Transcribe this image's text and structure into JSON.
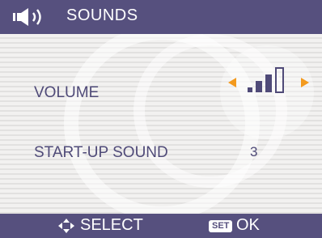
{
  "header": {
    "icon": "speaker-icon",
    "title": "SOUNDS"
  },
  "menu": {
    "items": [
      {
        "label": "VOLUME",
        "control": "volume-level",
        "level": 3,
        "max_level": 4
      },
      {
        "label": "START-UP SOUND",
        "value": "3"
      }
    ]
  },
  "footer": {
    "nav_icon": "four-way-arrow-icon",
    "select_label": "SELECT",
    "set_badge": "SET",
    "ok_label": "OK"
  },
  "colors": {
    "bar_bg": "#56507e",
    "text": "#4f4a78",
    "arrow": "#f39a1e",
    "background": "#ecebea"
  }
}
